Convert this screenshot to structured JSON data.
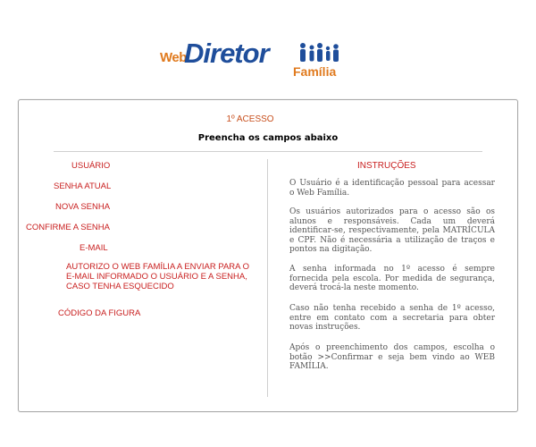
{
  "logo": {
    "web": "Web",
    "diretor": "Diretor",
    "familia": "Família"
  },
  "header": {
    "title": "1º ACESSO",
    "subtitle": "Preencha os campos abaixo"
  },
  "form": {
    "usuario": "USUÁRIO",
    "senha_atual": "SENHA ATUAL",
    "nova_senha": "NOVA SENHA",
    "confirme_senha": "CONFIRME A SENHA",
    "email": "E-MAIL",
    "autorizo": "AUTORIZO O WEB FAMÍLIA A ENVIAR PARA O E-MAIL INFORMADO O USUÁRIO E A SENHA, CASO TENHA ESQUECIDO",
    "codigo_figura": "CÓDIGO DA FIGURA"
  },
  "instructions": {
    "title": "INSTRUÇÕES",
    "p1": "O Usuário é a identificação pessoal para acessar o Web Família.",
    "p2": "Os usuários autorizados para o acesso são os alunos e responsáveis. Cada um deverá identificar-se, respectivamente, pela MATRÍCULA e CPF. Não é necessária a utilização de traços e pontos na digitação.",
    "p3": "A senha informada no 1º acesso é sempre fornecida pela escola. Por medida de segurança, deverá trocá-la neste momento.",
    "p4": "Caso não tenha recebido a senha de 1º acesso, entre em contato com a secretaria para obter novas instruções.",
    "p5": "Após o preenchimento dos campos, escolha o botão >>Confirmar e seja bem vindo ao WEB FAMÍLIA."
  },
  "colors": {
    "label": "#c81e1e",
    "brand_blue": "#1f4e9b",
    "brand_orange": "#e07a1e"
  }
}
